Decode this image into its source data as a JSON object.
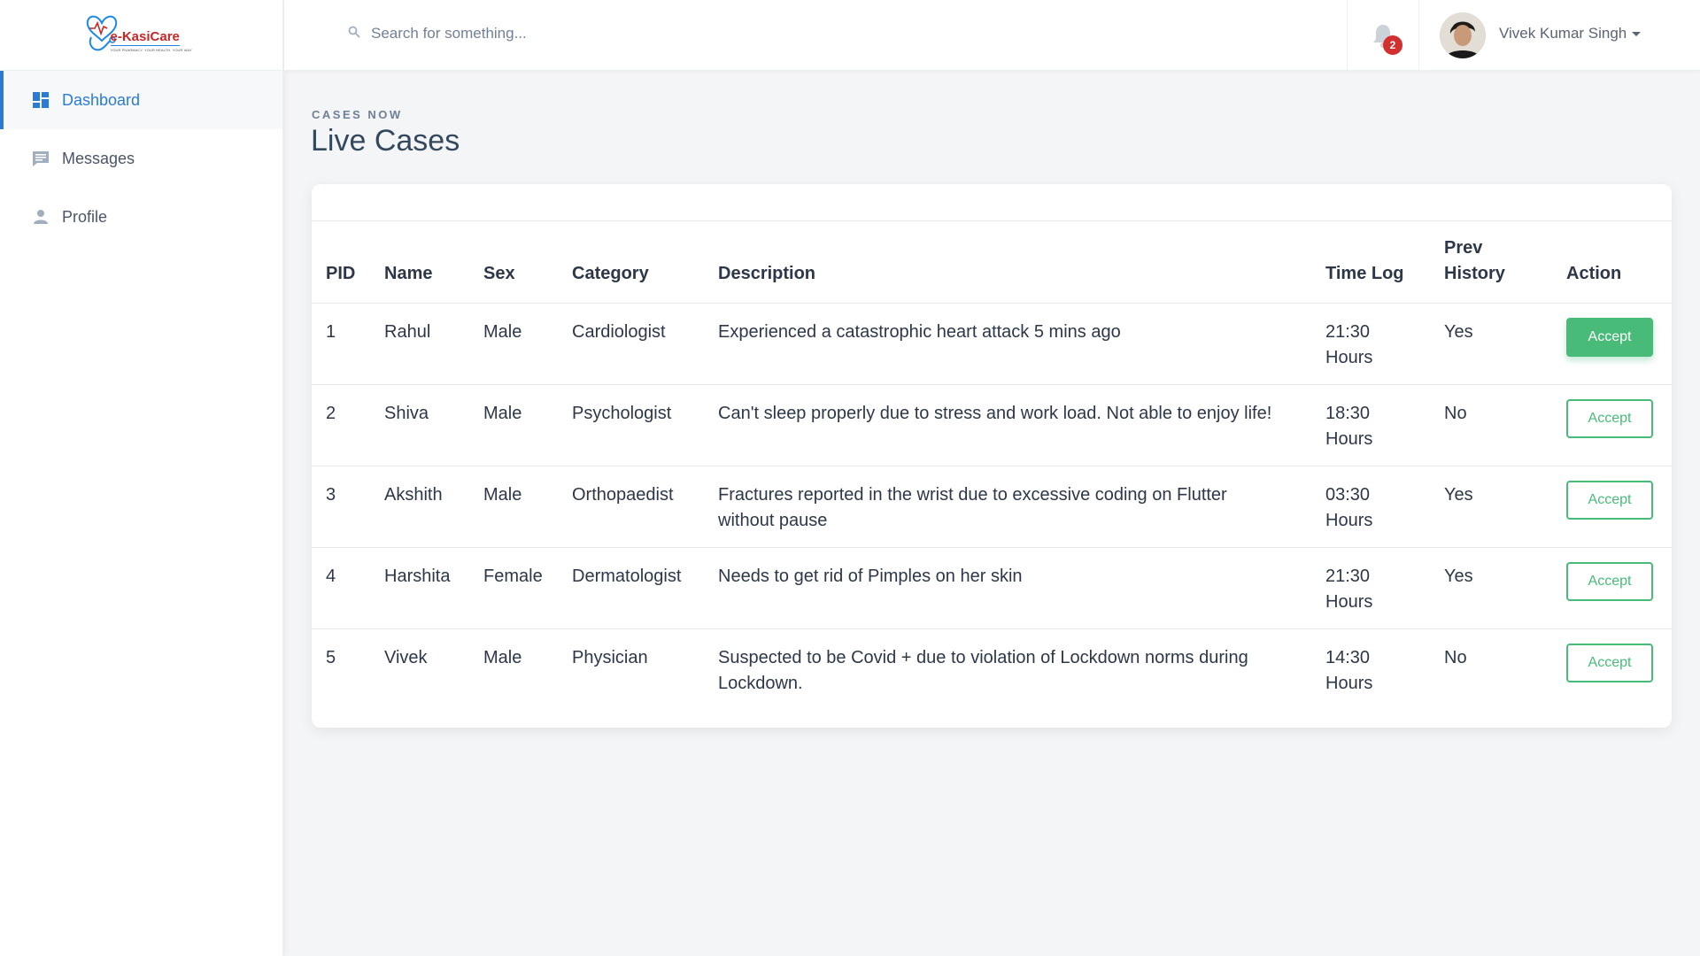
{
  "brand": {
    "name": "e-KasiCare",
    "tagline": "YOUR PHARMACY. YOUR HEALTH. YOUR WAY"
  },
  "sidebar": {
    "items": [
      {
        "label": "Dashboard",
        "icon": "dashboard-icon",
        "active": true
      },
      {
        "label": "Messages",
        "icon": "chat-icon",
        "active": false
      },
      {
        "label": "Profile",
        "icon": "user-icon",
        "active": false
      }
    ]
  },
  "topbar": {
    "search_placeholder": "Search for something...",
    "notification_count": "2",
    "user_name": "Vivek Kumar Singh"
  },
  "page": {
    "eyebrow": "CASES NOW",
    "title": "Live Cases"
  },
  "table": {
    "headers": {
      "pid": "PID",
      "name": "Name",
      "sex": "Sex",
      "category": "Category",
      "description": "Description",
      "time_log": "Time Log",
      "prev_history": "Prev History",
      "action": "Action"
    },
    "rows": [
      {
        "pid": "1",
        "name": "Rahul",
        "sex": "Male",
        "category": "Cardiologist",
        "description": "Experienced a catastrophic heart attack 5 mins ago",
        "time_log": "21:30 Hours",
        "prev_history": "Yes",
        "action": "Accept"
      },
      {
        "pid": "2",
        "name": "Shiva",
        "sex": "Male",
        "category": "Psychologist",
        "description": "Can't sleep properly due to stress and work load. Not able to enjoy life!",
        "time_log": "18:30 Hours",
        "prev_history": "No",
        "action": "Accept"
      },
      {
        "pid": "3",
        "name": "Akshith",
        "sex": "Male",
        "category": "Orthopaedist",
        "description": "Fractures reported in the wrist due to excessive coding on Flutter without pause",
        "time_log": "03:30 Hours",
        "prev_history": "Yes",
        "action": "Accept"
      },
      {
        "pid": "4",
        "name": "Harshita",
        "sex": "Female",
        "category": "Dermatologist",
        "description": "Needs to get rid of Pimples on her skin",
        "time_log": "21:30 Hours",
        "prev_history": "Yes",
        "action": "Accept"
      },
      {
        "pid": "5",
        "name": "Vivek",
        "sex": "Male",
        "category": "Physician",
        "description": "Suspected to be Covid + due to violation of Lockdown norms during Lockdown.",
        "time_log": "14:30 Hours",
        "prev_history": "No",
        "action": "Accept"
      }
    ]
  },
  "colors": {
    "accent": "#2b7bd6",
    "success": "#48bb78",
    "badge": "#d32f2f"
  }
}
